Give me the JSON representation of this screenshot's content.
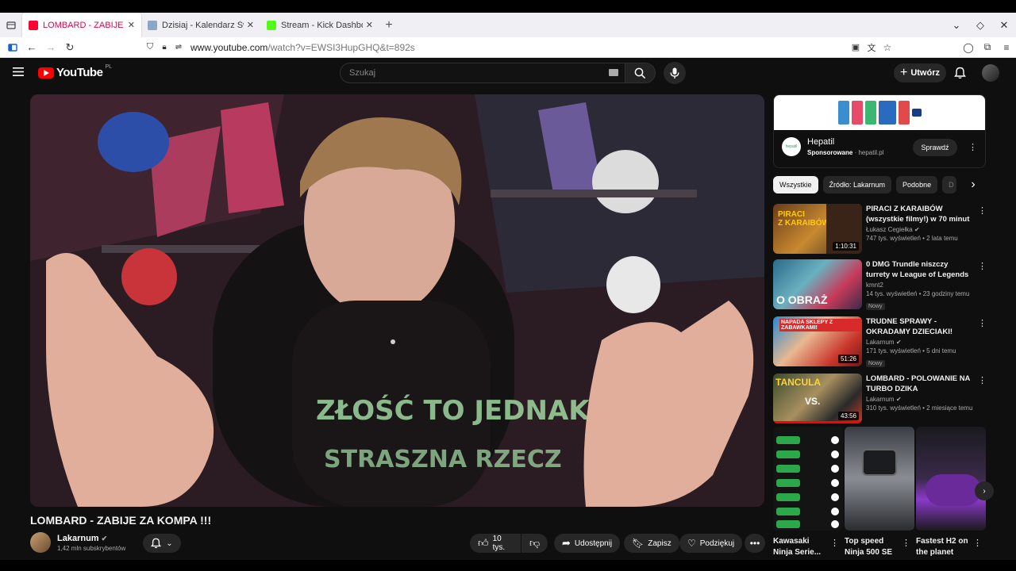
{
  "browser": {
    "tabs": [
      {
        "label": "LOMBARD - ZABIJE ZA K",
        "favicon_color": "#ff0033"
      },
      {
        "label": "Dzisiaj - Kalendarz Świąt",
        "favicon_color": "#8aa6c9"
      },
      {
        "label": "Stream - Kick Dashboard",
        "favicon_color": "#53fc18"
      }
    ],
    "new_tab": "+",
    "url_domain": "www.youtube.com",
    "url_path": "/watch?v=EWSI3HupGHQ&t=892s"
  },
  "youtube": {
    "logo_word": "YouTube",
    "country_code": "PL",
    "search_placeholder": "Szukaj",
    "create_label": "Utwórz",
    "video": {
      "title": "LOMBARD - ZABIJE ZA KOMPA !!!",
      "channel": "Lakarnum",
      "subscribers": "1,42 mln subskrybentów",
      "likes": "10 tys.",
      "share": "Udostępnij",
      "save": "Zapisz",
      "thanks": "Podziękuj"
    },
    "ad": {
      "name": "Hepatil",
      "sponsored": "Sponsorowane",
      "domain": "hepatil.pl",
      "cta": "Sprawdź",
      "logo_text": "hepatil"
    },
    "chips": [
      "Wszystkie",
      "Źródło: Lakarnum",
      "Podobne",
      "D"
    ],
    "recommendations": [
      {
        "title": "PIRACI Z KARAIBÓW (wszystkie filmy!) w 70 minut | Szyderczy ...",
        "channel": "Łukasz Cegiełka",
        "views": "747 tys. wyświetleń • 2 lata temu",
        "duration": "1:10:31",
        "badge": ""
      },
      {
        "title": "0 DMG Trundle niszczy turrety w League of Legends",
        "channel": "kmnt2",
        "views": "14 tys. wyświetleń • 23 godziny temu",
        "duration": "",
        "badge": "Nowy"
      },
      {
        "title": "TRUDNE SPRAWY - OKRADAMY DZIECIAKI!",
        "channel": "Lakarnum",
        "views": "171 tys. wyświetleń • 5 dni temu",
        "duration": "51:26",
        "badge": "Nowy"
      },
      {
        "title": "LOMBARD - POLOWANIE NA TURBO DZIKA",
        "channel": "Lakarnum",
        "views": "310 tys. wyświetleń • 2 miesiące temu",
        "duration": "43:56",
        "badge": ""
      }
    ],
    "shorts": [
      {
        "title": "Kawasaki Ninja Serie..."
      },
      {
        "title": "Top speed Ninja 500 SE"
      },
      {
        "title": "Fastest H2 on the planet"
      }
    ]
  }
}
